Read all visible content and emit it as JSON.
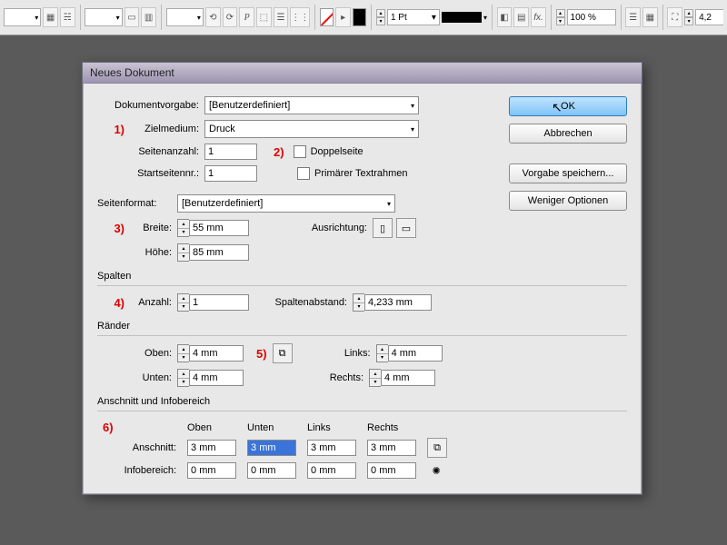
{
  "toolbar": {
    "pt_value": "1 Pt",
    "zoom": "100 %",
    "right_num": "4,2"
  },
  "dialog": {
    "title": "Neues Dokument",
    "labels": {
      "dokumentvorgabe": "Dokumentvorgabe:",
      "zielmedium": "Zielmedium:",
      "seitenanzahl": "Seitenanzahl:",
      "startseitennr": "Startseitennr.:",
      "doppelseite": "Doppelseite",
      "primaerer_textrahmen": "Primärer Textrahmen",
      "seitenformat": "Seitenformat:",
      "breite": "Breite:",
      "hoehe": "Höhe:",
      "ausrichtung": "Ausrichtung:",
      "spalten": "Spalten",
      "anzahl": "Anzahl:",
      "spaltenabstand": "Spaltenabstand:",
      "raender": "Ränder",
      "oben": "Oben:",
      "unten": "Unten:",
      "links": "Links:",
      "rechts": "Rechts:",
      "anschnitt_info": "Anschnitt und Infobereich",
      "anschnitt": "Anschnitt:",
      "infobereich": "Infobereich:",
      "col_oben": "Oben",
      "col_unten": "Unten",
      "col_links": "Links",
      "col_rechts": "Rechts"
    },
    "values": {
      "dokumentvorgabe": "[Benutzerdefiniert]",
      "zielmedium": "Druck",
      "seitenanzahl": "1",
      "startseitennr": "1",
      "seitenformat": "[Benutzerdefiniert]",
      "breite": "55 mm",
      "hoehe": "85 mm",
      "spalten_anzahl": "1",
      "spaltenabstand": "4,233 mm",
      "rand_oben": "4 mm",
      "rand_unten": "4 mm",
      "rand_links": "4 mm",
      "rand_rechts": "4 mm",
      "anschnitt_oben": "3 mm",
      "anschnitt_unten": "3 mm",
      "anschnitt_links": "3 mm",
      "anschnitt_rechts": "3 mm",
      "info_oben": "0 mm",
      "info_unten": "0 mm",
      "info_links": "0 mm",
      "info_rechts": "0 mm"
    },
    "buttons": {
      "ok": "OK",
      "abbrechen": "Abbrechen",
      "vorgabe_speichern": "Vorgabe speichern...",
      "weniger_optionen": "Weniger Optionen"
    },
    "annotations": {
      "a1": "1)",
      "a2": "2)",
      "a3": "3)",
      "a4": "4)",
      "a5": "5)",
      "a6": "6)"
    }
  }
}
